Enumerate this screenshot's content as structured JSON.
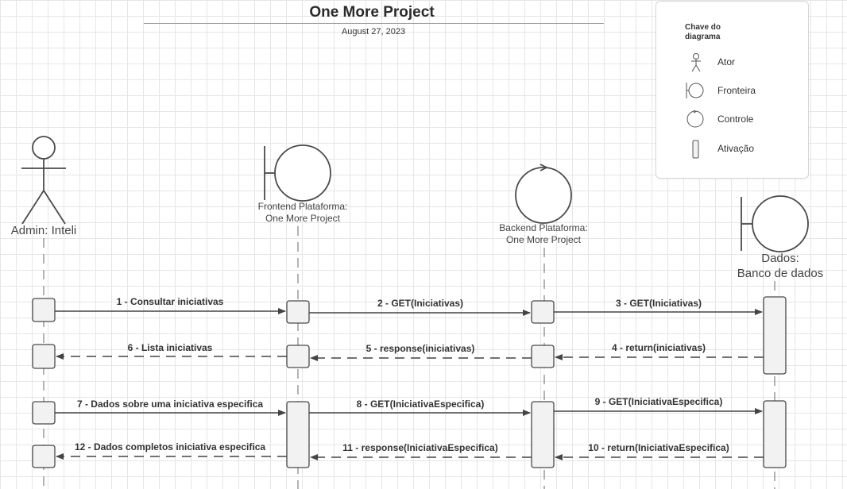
{
  "header": {
    "title": "One More Project",
    "date": "August 27, 2023"
  },
  "legend": {
    "title": "Chave do diagrama",
    "items": [
      {
        "icon": "actor-icon",
        "label": "Ator"
      },
      {
        "icon": "boundary-icon",
        "label": "Fronteira"
      },
      {
        "icon": "control-icon",
        "label": "Controle"
      },
      {
        "icon": "activation-icon",
        "label": "Ativação"
      }
    ]
  },
  "participants": [
    {
      "name": "Admin: Inteli",
      "type": "actor"
    },
    {
      "name": "Frontend Plataforma: One More Project",
      "line1": "Frontend Plataforma:",
      "line2": "One More Project",
      "type": "boundary"
    },
    {
      "name": "Backend Plataforma: One More Project",
      "line1": "Backend Plataforma:",
      "line2": "One More Project",
      "type": "control"
    },
    {
      "name": "Dados: Banco de dados",
      "line1": "Dados:",
      "line2": "Banco de dados",
      "type": "boundary"
    }
  ],
  "messages": [
    {
      "text": "1 - Consultar iniciativas",
      "from": 0,
      "to": 1,
      "style": "solid"
    },
    {
      "text": "2 - GET(Iniciativas)",
      "from": 1,
      "to": 2,
      "style": "solid"
    },
    {
      "text": "3 - GET(Iniciativas)",
      "from": 2,
      "to": 3,
      "style": "solid"
    },
    {
      "text": "4 - return(iniciativas)",
      "from": 3,
      "to": 2,
      "style": "dashed"
    },
    {
      "text": "5 - response(iniciativas)",
      "from": 2,
      "to": 1,
      "style": "dashed"
    },
    {
      "text": "6 - Lista iniciativas",
      "from": 1,
      "to": 0,
      "style": "dashed"
    },
    {
      "text": "7 - Dados sobre uma iniciativa especifica",
      "from": 0,
      "to": 1,
      "style": "solid"
    },
    {
      "text": "8 - GET(IniciativaEspecifica)",
      "from": 1,
      "to": 2,
      "style": "solid"
    },
    {
      "text": "9 - GET(IniciativaEspecifica)",
      "from": 2,
      "to": 3,
      "style": "solid"
    },
    {
      "text": "10 - return(IniciativaEspecifica)",
      "from": 3,
      "to": 2,
      "style": "dashed"
    },
    {
      "text": "11 - response(IniciativaEspecifica)",
      "from": 2,
      "to": 1,
      "style": "dashed"
    },
    {
      "text": "12 - Dados completos iniciativa especifica",
      "from": 1,
      "to": 0,
      "style": "dashed"
    }
  ]
}
